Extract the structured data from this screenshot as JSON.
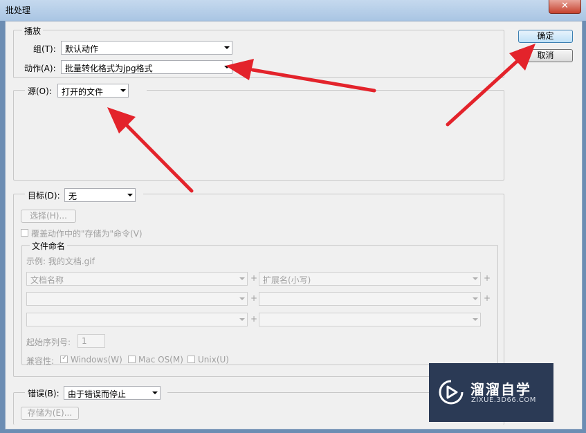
{
  "window": {
    "title": "批处理",
    "close_glyph": "✕"
  },
  "buttons": {
    "ok": "确定",
    "cancel": "取消"
  },
  "play": {
    "legend": "播放",
    "group_label": "组(T):",
    "group_value": "默认动作",
    "action_label": "动作(A):",
    "action_value": "批量转化格式为jpg格式"
  },
  "source": {
    "label": "源(O):",
    "value": "打开的文件"
  },
  "target": {
    "label": "目标(D):",
    "value": "无",
    "choose_button": "选择(H)...",
    "override_label": "覆盖动作中的\"存储为\"命令(V)",
    "naming": {
      "legend": "文件命名",
      "example": "示例: 我的文档.gif",
      "field1": "文档名称",
      "field2": "扩展名(小写)",
      "plus": "+",
      "serial_label": "起始序列号:",
      "serial_value": "1",
      "compat_label": "兼容性:",
      "compat": [
        "Windows(W)",
        "Mac OS(M)",
        "Unix(U)"
      ]
    }
  },
  "errors": {
    "label": "错误(B):",
    "value": "由于错误而停止",
    "save_button": "存储为(E)..."
  },
  "watermark": {
    "brand": "溜溜自学",
    "url": "ZIXUE.3D66.COM"
  },
  "colors": {
    "annotation_arrow": "#e3232b",
    "titlebar": "#b7cfe8",
    "dialog_bg": "#f0f0f0"
  }
}
